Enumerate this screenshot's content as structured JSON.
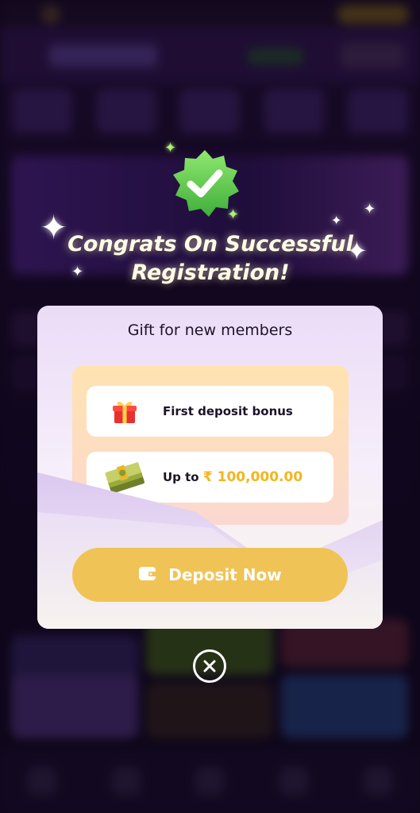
{
  "modal": {
    "congrats_line1": "Congrats On Successful",
    "congrats_line2": "Registration!",
    "card_title": "Gift for new members",
    "rewards": [
      {
        "icon": "gift-box-icon",
        "label": "First deposit bonus"
      },
      {
        "icon": "cash-stack-icon",
        "label": "Up to",
        "currency": "₹",
        "amount": "100,000.00"
      }
    ],
    "deposit_button": {
      "label": "Deposit Now",
      "icon": "wallet-icon"
    },
    "close_icon": "close-circle-icon"
  },
  "colors": {
    "button": "#f0c357",
    "amount": "#f2b51c",
    "badge": "#6fd65c",
    "card_top": "#ebdcf7"
  }
}
